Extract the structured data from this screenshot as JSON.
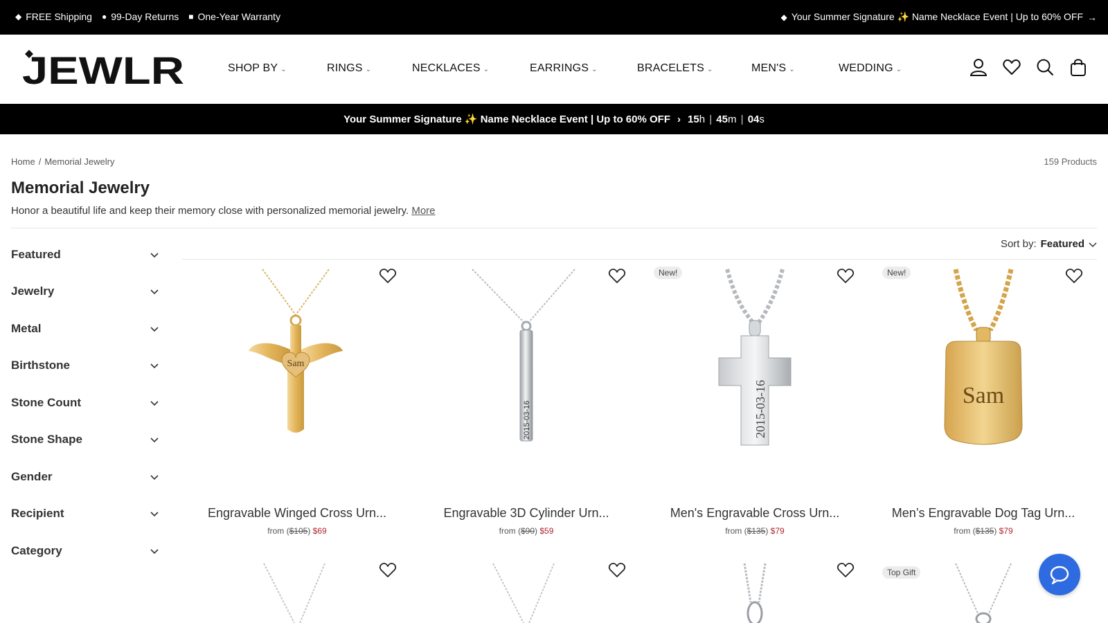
{
  "topbar": {
    "left": [
      {
        "icon": "diamond-icon",
        "label": "FREE Shipping"
      },
      {
        "icon": "dot-icon",
        "label": "99-Day Returns"
      },
      {
        "icon": "square-icon",
        "label": "One-Year Warranty"
      }
    ],
    "right": {
      "icon": "diamond-icon",
      "label": "Your Summer Signature ✨ Name Necklace Event | Up to 60% OFF",
      "arrow": "→"
    }
  },
  "header": {
    "logo": "JEWLR",
    "nav": [
      {
        "label": "SHOP BY"
      },
      {
        "label": "RINGS"
      },
      {
        "label": "NECKLACES"
      },
      {
        "label": "EARRINGS"
      },
      {
        "label": "BRACELETS"
      },
      {
        "label": "MEN'S"
      },
      {
        "label": "WEDDING"
      }
    ],
    "icons": [
      "account-icon",
      "wishlist-icon",
      "search-icon",
      "cart-icon"
    ]
  },
  "event": {
    "text": "Your Summer Signature ✨ Name Necklace Event | Up to 60% OFF",
    "arrow": "›",
    "hours": "15",
    "hours_unit": "h",
    "minutes": "45",
    "minutes_unit": "m",
    "seconds": "04",
    "seconds_unit": "s",
    "separator": "|"
  },
  "breadcrumb": {
    "home": "Home",
    "sep": "/",
    "current": "Memorial Jewelry"
  },
  "count": "159 Products",
  "page": {
    "title": "Memorial Jewelry",
    "description": "Honor a beautiful life and keep their memory close with personalized memorial jewelry.",
    "more": "More"
  },
  "sort": {
    "label": "Sort by:",
    "value": "Featured"
  },
  "filters": [
    "Featured",
    "Jewelry",
    "Metal",
    "Birthstone",
    "Stone Count",
    "Stone Shape",
    "Gender",
    "Recipient",
    "Category"
  ],
  "products": [
    {
      "name": "Engravable Winged Cross Urn...",
      "from": "from (",
      "orig": "$105",
      "close": ")",
      "sale": "$69",
      "badge": "",
      "engraving": "Sam"
    },
    {
      "name": "Engravable 3D Cylinder Urn...",
      "from": "from (",
      "orig": "$90",
      "close": ")",
      "sale": "$59",
      "badge": "",
      "engraving": "2015-03-16"
    },
    {
      "name": "Men's Engravable Cross Urn...",
      "from": "from (",
      "orig": "$135",
      "close": ")",
      "sale": "$79",
      "badge": "New!",
      "engraving": "2015-03-16"
    },
    {
      "name": "Men’s Engravable Dog Tag Urn...",
      "from": "from (",
      "orig": "$135",
      "close": ")",
      "sale": "$79",
      "badge": "New!",
      "engraving": "Sam"
    }
  ],
  "second_row": [
    {
      "badge": ""
    },
    {
      "badge": ""
    },
    {
      "badge": ""
    },
    {
      "badge": "Top Gift"
    }
  ],
  "colors": {
    "accent": "#2f6be0",
    "sale": "#b0242d",
    "gold": "#e4b45a",
    "silver": "#c9ccd0"
  }
}
